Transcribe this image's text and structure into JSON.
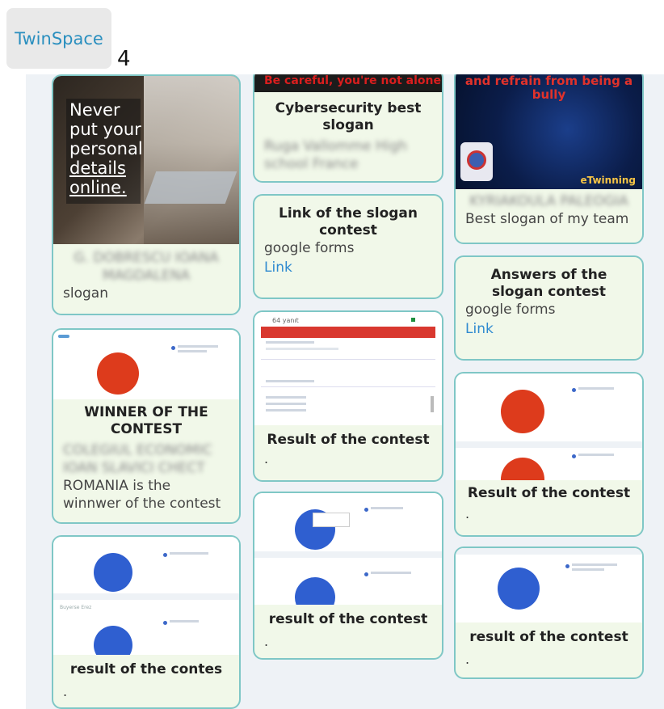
{
  "app": {
    "name": "TwinSpace",
    "counter": "4"
  },
  "cards": {
    "slogan_photo": {
      "image_text": [
        "Never",
        "put your",
        "personal",
        "details",
        "online."
      ],
      "author_blurred": "G. DOBRESCU IOANA MAGDALENA",
      "desc": "slogan"
    },
    "cyber_best": {
      "banner_text": "Be careful, you're not alone",
      "title": "Cybersecurity best slogan",
      "author_blurred": "Ruga Vallomme High school France"
    },
    "team_slogan": {
      "banner_text": "and refrain from being a bully",
      "author_blurred": "KYRIAKOULA PALEOGIA",
      "desc": "Best slogan of my team",
      "logo_text": "eTwinning"
    },
    "link_slogan": {
      "title": "Link of the slogan contest",
      "desc": "google forms",
      "link": "Link"
    },
    "answers_slogan": {
      "title": "Answers of the slogan contest",
      "desc": "google forms",
      "link": "Link"
    },
    "winner": {
      "title": "WINNER OF THE CONTEST",
      "author_blurred": "COLEGIUL ECONOMIC IOAN SLAVICI CHECT",
      "desc": "ROMANIA is the winnwer of the contest"
    },
    "result_mid": {
      "title": "Result of the contest",
      "dot": ".",
      "form_title": "64 yanıt"
    },
    "result_right": {
      "title": "Result of the contest",
      "dot": "."
    },
    "result_mid2": {
      "title": "result of the contest",
      "dot": "."
    },
    "result_right2": {
      "title": "result of the contest",
      "dot": "."
    },
    "result_left": {
      "title": "result of the contes",
      "dot": ".",
      "chart_caption": "Buyerse Erez"
    }
  },
  "colors": {
    "accent": "#2f8ad0",
    "border": "#7fc7c6",
    "card_bg": "#f1f8e9",
    "pie_red": "#dd3b1c",
    "pie_blue": "#2f5fd0"
  }
}
